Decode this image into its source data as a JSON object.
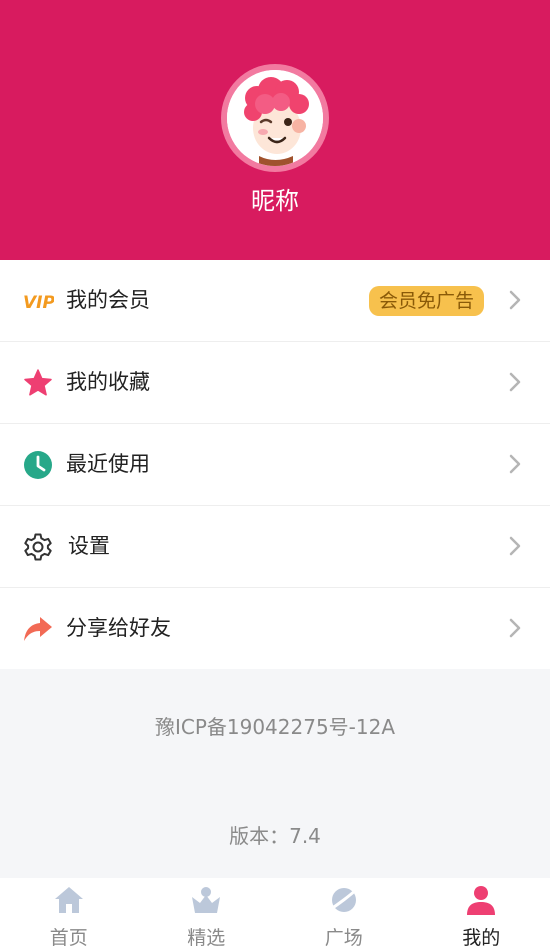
{
  "profile": {
    "nickname": "昵称",
    "avatar_icon": "cartoon-avatar-icon"
  },
  "menu": {
    "vip_icon_text": "VIP",
    "items": [
      {
        "label": "我的会员",
        "icon": "vip-icon",
        "badge": "会员免广告"
      },
      {
        "label": "我的收藏",
        "icon": "star-icon"
      },
      {
        "label": "最近使用",
        "icon": "clock-icon"
      },
      {
        "label": "设置",
        "icon": "gear-icon"
      },
      {
        "label": "分享给好友",
        "icon": "share-arrow-icon"
      }
    ]
  },
  "footer": {
    "icp": "豫ICP备19042275号-12A",
    "version": "版本：7.4"
  },
  "tabs": [
    {
      "label": "首页",
      "icon": "home-icon",
      "active": false
    },
    {
      "label": "精选",
      "icon": "crown-icon",
      "active": false
    },
    {
      "label": "广场",
      "icon": "planet-icon",
      "active": false
    },
    {
      "label": "我的",
      "icon": "user-icon",
      "active": true
    }
  ],
  "colors": {
    "header_bg": "#d81b5f",
    "accent_pink": "#ee3f72",
    "badge_bg": "#f7c14d",
    "vip_orange": "#f39a1f",
    "clock_green": "#27a889",
    "share_coral": "#f26a55",
    "inactive_tab": "#bcc8da"
  }
}
